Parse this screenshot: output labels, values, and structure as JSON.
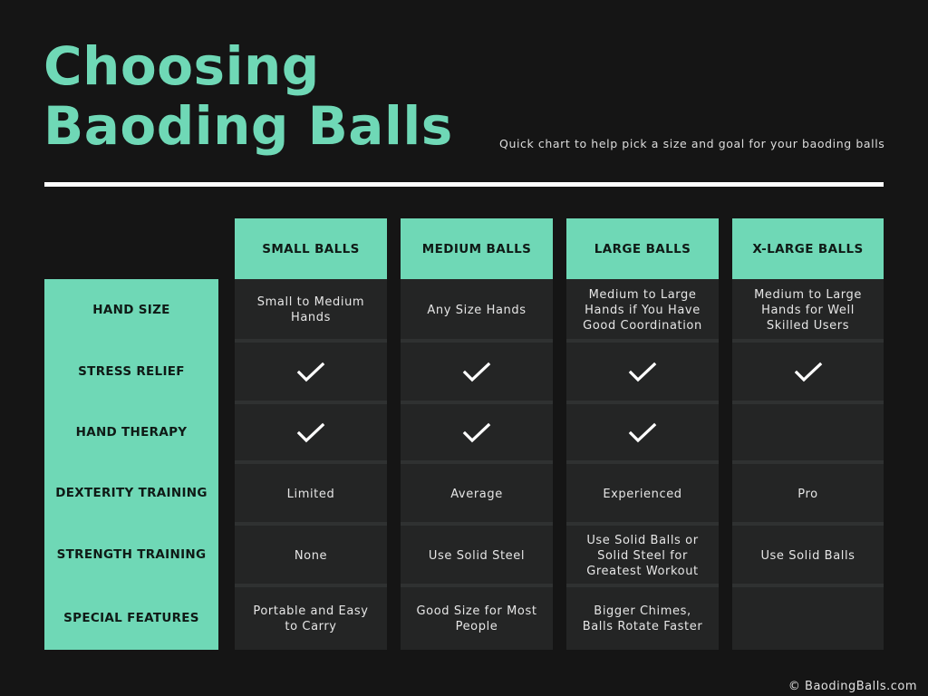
{
  "header": {
    "title_line1": "Choosing",
    "title_line2": "Baoding Balls",
    "subtitle": "Quick chart to help pick a size and goal for your baoding balls"
  },
  "colors": {
    "accent": "#6fd8b6",
    "background": "#151515",
    "cell_background": "#242525",
    "divider": "#ffffff"
  },
  "table": {
    "columns": [
      "SMALL BALLS",
      "MEDIUM BALLS",
      "LARGE BALLS",
      "X-LARGE BALLS"
    ],
    "rows": [
      {
        "label": "HAND SIZE",
        "cells": [
          {
            "type": "text",
            "value": "Small to Medium Hands"
          },
          {
            "type": "text",
            "value": "Any Size Hands"
          },
          {
            "type": "text",
            "value": "Medium to Large Hands if You Have Good Coordination"
          },
          {
            "type": "text",
            "value": "Medium to Large Hands for Well Skilled Users"
          }
        ]
      },
      {
        "label": "STRESS RELIEF",
        "cells": [
          {
            "type": "check",
            "value": true,
            "icon": "checkmark-icon"
          },
          {
            "type": "check",
            "value": true,
            "icon": "checkmark-icon"
          },
          {
            "type": "check",
            "value": true,
            "icon": "checkmark-icon"
          },
          {
            "type": "check",
            "value": true,
            "icon": "checkmark-icon"
          }
        ]
      },
      {
        "label": "HAND THERAPY",
        "cells": [
          {
            "type": "check",
            "value": true,
            "icon": "checkmark-icon"
          },
          {
            "type": "check",
            "value": true,
            "icon": "checkmark-icon"
          },
          {
            "type": "check",
            "value": true,
            "icon": "checkmark-icon"
          },
          {
            "type": "empty",
            "value": ""
          }
        ]
      },
      {
        "label": "DEXTERITY TRAINING",
        "cells": [
          {
            "type": "text",
            "value": "Limited"
          },
          {
            "type": "text",
            "value": "Average"
          },
          {
            "type": "text",
            "value": "Experienced"
          },
          {
            "type": "text",
            "value": "Pro"
          }
        ]
      },
      {
        "label": "STRENGTH TRAINING",
        "cells": [
          {
            "type": "text",
            "value": "None"
          },
          {
            "type": "text",
            "value": "Use Solid Steel"
          },
          {
            "type": "text",
            "value": "Use Solid Balls or Solid Steel for Greatest Workout"
          },
          {
            "type": "text",
            "value": "Use Solid Balls"
          }
        ]
      },
      {
        "label": "SPECIAL FEATURES",
        "cells": [
          {
            "type": "text",
            "value": "Portable and Easy to Carry"
          },
          {
            "type": "text",
            "value": "Good Size for Most People"
          },
          {
            "type": "text",
            "value": "Bigger Chimes, Balls Rotate Faster"
          },
          {
            "type": "empty",
            "value": ""
          }
        ]
      }
    ]
  },
  "footer": {
    "copyright": "© BaodingBalls.com"
  }
}
